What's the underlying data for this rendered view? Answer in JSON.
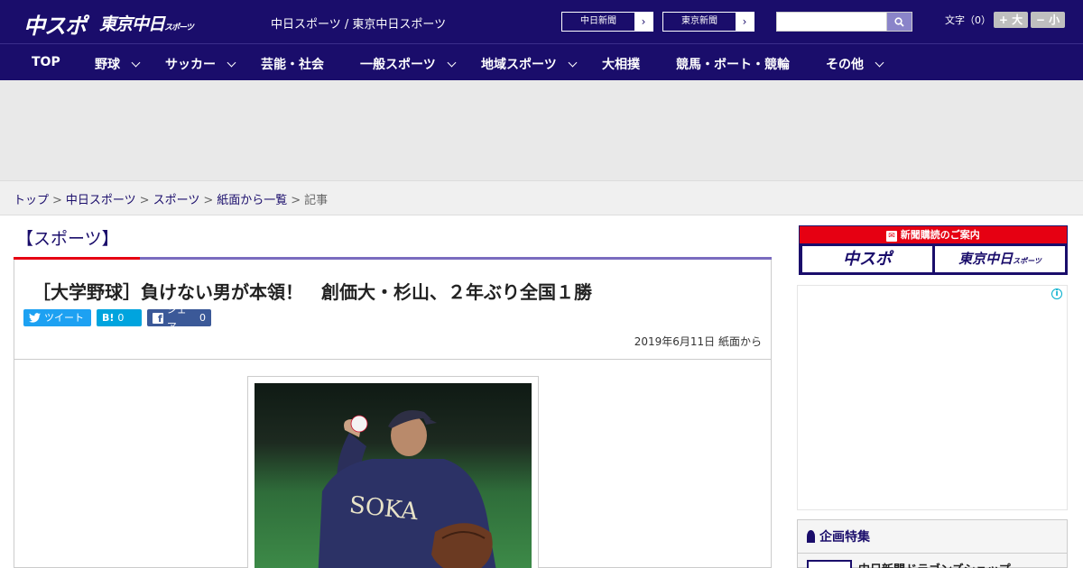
{
  "header": {
    "logo_main": "中スポ",
    "logo_tokyo": "東京中日",
    "logo_tokyo_sub": "スポーツ",
    "site_links": "中日スポーツ / 東京中日スポーツ",
    "newspaper_buttons": [
      "中日新聞",
      "東京新聞"
    ],
    "font_size_label": "文字（0）",
    "font_larger": "+ 大",
    "font_smaller": "− 小"
  },
  "nav": {
    "items": [
      {
        "label": "TOP",
        "dropdown": false
      },
      {
        "label": "野球",
        "dropdown": true
      },
      {
        "label": "サッカー",
        "dropdown": true
      },
      {
        "label": "芸能・社会",
        "dropdown": false
      },
      {
        "label": "一般スポーツ",
        "dropdown": true
      },
      {
        "label": "地域スポーツ",
        "dropdown": true
      },
      {
        "label": "大相撲",
        "dropdown": false
      },
      {
        "label": "競馬・ボート・競輪",
        "dropdown": false
      },
      {
        "label": "その他",
        "dropdown": true
      }
    ]
  },
  "breadcrumb": {
    "links": [
      "トップ",
      "中日スポーツ",
      "スポーツ",
      "紙面から一覧"
    ],
    "current": "記事"
  },
  "article": {
    "category": "【スポーツ】",
    "headline": "［大学野球］負けない男が本領！　創価大・杉山、２年ぶり全国１勝",
    "share": {
      "tweet_label": "ツイート",
      "hatena_label": "B!",
      "hatena_count": "0",
      "facebook_label": "シェア",
      "facebook_count": "0"
    },
    "date": "2019年6月11日 紙面から",
    "photo_jersey_text": "SOKA"
  },
  "sidebar": {
    "subscription_title": "新聞購読のご案内",
    "subscription_logos": [
      "中スポ",
      "東京中日"
    ],
    "subscription_logo_sub": "スポーツ",
    "ad_info_icon": "i",
    "feature_title": "企画特集",
    "feature_item": "中日新聞ドラゴンズショップ"
  },
  "colors": {
    "brand_navy": "#1a0d6b",
    "accent_red": "#e60012",
    "twitter": "#1da1f2",
    "hatena": "#00a4de",
    "facebook": "#3b5998"
  }
}
